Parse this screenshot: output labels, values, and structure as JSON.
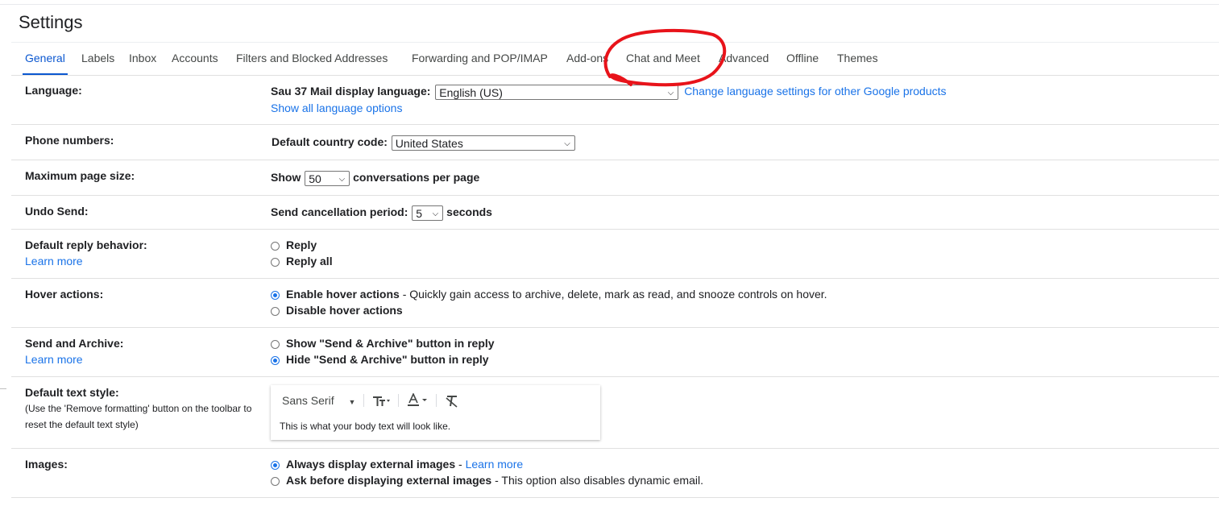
{
  "header": {
    "title": "Settings"
  },
  "tabs": [
    {
      "label": "General",
      "active": true
    },
    {
      "label": "Labels"
    },
    {
      "label": "Inbox"
    },
    {
      "label": "Accounts"
    },
    {
      "label": "Filters and Blocked Addresses"
    },
    {
      "label": "Forwarding and POP/IMAP"
    },
    {
      "label": "Add-ons"
    },
    {
      "label": "Chat and Meet"
    },
    {
      "label": "Advanced"
    },
    {
      "label": "Offline"
    },
    {
      "label": "Themes"
    }
  ],
  "settings": {
    "language": {
      "label": "Language:",
      "display_label": "Sau 37 Mail display language:",
      "selected": "English (US)",
      "change_link": "Change language settings for other Google products",
      "show_all_link": "Show all language options"
    },
    "phone": {
      "label": "Phone numbers:",
      "country_label": "Default country code:",
      "selected": "United States"
    },
    "page_size": {
      "label": "Maximum page size:",
      "show": "Show",
      "selected": "50",
      "suffix": "conversations per page"
    },
    "undo_send": {
      "label": "Undo Send:",
      "period_label": "Send cancellation period:",
      "selected": "5",
      "suffix": "seconds"
    },
    "reply": {
      "label": "Default reply behavior:",
      "learn_more": "Learn more",
      "options": [
        "Reply",
        "Reply all"
      ]
    },
    "hover": {
      "label": "Hover actions:",
      "enable": "Enable hover actions",
      "enable_desc": " - Quickly gain access to archive, delete, mark as read, and snooze controls on hover.",
      "disable": "Disable hover actions"
    },
    "send_archive": {
      "label": "Send and Archive:",
      "learn_more": "Learn more",
      "show": "Show \"Send & Archive\" button in reply",
      "hide": "Hide \"Send & Archive\" button in reply"
    },
    "text_style": {
      "label": "Default text style:",
      "note_line1": "(Use the 'Remove formatting' button on the toolbar to",
      "note_line2": "reset the default text style)",
      "font": "Sans Serif",
      "preview": "This is what your body text will look like."
    },
    "images": {
      "label": "Images:",
      "always": "Always display external images",
      "learn_more": "Learn more",
      "ask": "Ask before displaying external images",
      "ask_desc": " - This option also disables dynamic email."
    }
  },
  "colors": {
    "accent": "#1a73e8",
    "annotation": "#e8131a"
  },
  "icons": [
    "chevron-down-icon",
    "text-size-icon",
    "text-color-icon",
    "remove-formatting-icon"
  ]
}
